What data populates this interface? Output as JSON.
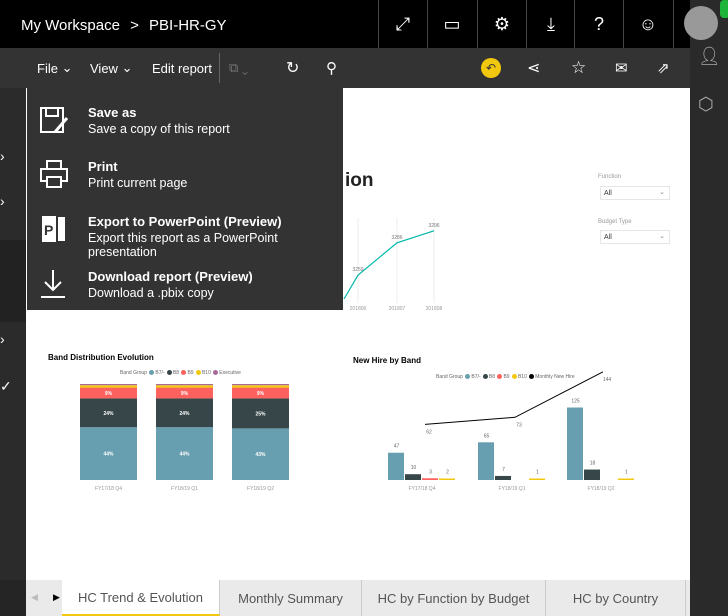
{
  "header": {
    "workspace": "My Workspace",
    "separator": ">",
    "report": "PBI-HR-GY",
    "icons": [
      "fullscreen-icon",
      "comment-icon",
      "gear-icon",
      "download-icon",
      "help-icon",
      "smiley-icon"
    ]
  },
  "toolbar": {
    "file": "File",
    "view": "View",
    "edit": "Edit report"
  },
  "menu": [
    {
      "title": "Save as",
      "desc": "Save a copy of this report",
      "icon": "save-as-icon"
    },
    {
      "title": "Print",
      "desc": "Print current page",
      "icon": "printer-icon"
    },
    {
      "title": "Export to PowerPoint (Preview)",
      "desc": "Export this report as a PowerPoint presentation",
      "icon": "powerpoint-icon"
    },
    {
      "title": "Download report (Preview)",
      "desc": "Download a .pbix copy",
      "icon": "download-icon"
    }
  ],
  "page": {
    "title_fragment": "ion"
  },
  "filters": {
    "function_label": "Function",
    "function_value": "All",
    "budget_label": "Budget Type",
    "budget_value": "All"
  },
  "colors": {
    "b7": "#689fb0",
    "b8": "#374649",
    "b9": "#fd625e",
    "b10": "#f2c80f",
    "exec": "#a66999",
    "line": "#01b8aa",
    "accent": "#f2c80f"
  },
  "chart_data": [
    {
      "type": "line",
      "x": [
        "201806",
        "201807",
        "201808"
      ],
      "values": [
        3259,
        3286,
        3296
      ]
    },
    {
      "type": "bar",
      "stacked": true,
      "title": "Band Distribution Evolution",
      "legend_title": "Band Group",
      "categories": [
        "FY17/18 Q4",
        "FY18/19 Q1",
        "FY18/19 Q2"
      ],
      "series": [
        {
          "name": "B7/-",
          "values": [
            44,
            44,
            43
          ],
          "labels": [
            "44%",
            "44%",
            "43%"
          ]
        },
        {
          "name": "B8",
          "values": [
            24,
            24,
            25
          ],
          "labels": [
            "24%",
            "24%",
            "25%"
          ]
        },
        {
          "name": "B9",
          "values": [
            9,
            9,
            9
          ],
          "labels": [
            "9%",
            "9%",
            "9%"
          ]
        },
        {
          "name": "B10",
          "values": [
            2,
            2,
            2
          ]
        },
        {
          "name": "Executive",
          "values": [
            1,
            1,
            1
          ]
        }
      ]
    },
    {
      "type": "bar",
      "title": "New Hire by Band",
      "legend_title": "Band Group",
      "categories": [
        "FY17/18 Q4",
        "FY18/19 Q1",
        "FY18/19 Q2"
      ],
      "series": [
        {
          "name": "B7/-",
          "values": [
            47,
            65,
            125
          ]
        },
        {
          "name": "B8",
          "values": [
            10,
            7,
            18
          ]
        },
        {
          "name": "B9",
          "values": [
            3,
            null,
            null
          ]
        },
        {
          "name": "B10",
          "values": [
            2,
            1,
            1
          ]
        }
      ],
      "line": {
        "name": "Monthly New Hire",
        "values": [
          62,
          73,
          144
        ]
      }
    }
  ],
  "tabs": [
    "HC Trend & Evolution",
    "Monthly Summary",
    "HC by Function by Budget",
    "HC by Country"
  ]
}
